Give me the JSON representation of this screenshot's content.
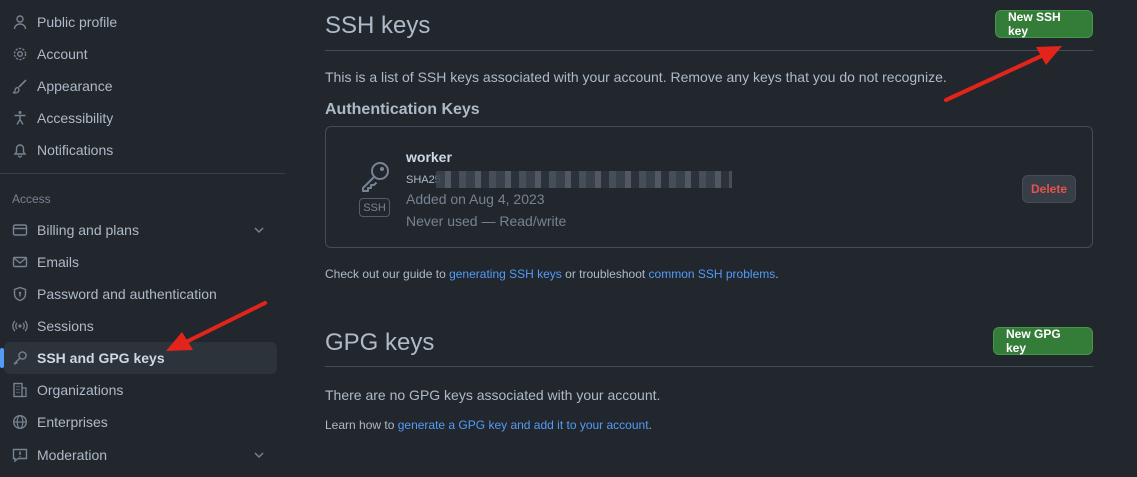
{
  "sidebar": {
    "items_top": [
      {
        "label": "Public profile",
        "icon": "person-icon"
      },
      {
        "label": "Account",
        "icon": "gear-icon"
      },
      {
        "label": "Appearance",
        "icon": "paintbrush-icon"
      },
      {
        "label": "Accessibility",
        "icon": "accessibility-icon"
      },
      {
        "label": "Notifications",
        "icon": "bell-icon"
      }
    ],
    "access_heading": "Access",
    "items_access": [
      {
        "label": "Billing and plans",
        "icon": "credit-card-icon"
      },
      {
        "label": "Emails",
        "icon": "mail-icon"
      },
      {
        "label": "Password and authentication",
        "icon": "shield-lock-icon"
      },
      {
        "label": "Sessions",
        "icon": "broadcast-icon"
      },
      {
        "label": "SSH and GPG keys",
        "icon": "key-icon"
      },
      {
        "label": "Organizations",
        "icon": "organization-icon"
      },
      {
        "label": "Enterprises",
        "icon": "globe-icon"
      },
      {
        "label": "Moderation",
        "icon": "report-icon"
      }
    ]
  },
  "ssh": {
    "title": "SSH keys",
    "new_button": "New SSH key",
    "description": "This is a list of SSH keys associated with your account. Remove any keys that you do not recognize.",
    "auth_heading": "Authentication Keys",
    "key": {
      "title": "worker",
      "fingerprint_prefix": "SHA25",
      "added": "Added on Aug 4, 2023",
      "usage": "Never used — Read/write",
      "badge": "SSH",
      "delete_label": "Delete"
    },
    "guide": {
      "prefix": "Check out our guide to ",
      "link1": "generating SSH keys",
      "middle": " or troubleshoot ",
      "link2": "common SSH problems",
      "suffix": "."
    }
  },
  "gpg": {
    "title": "GPG keys",
    "new_button": "New GPG key",
    "empty_text": "There are no GPG keys associated with your account.",
    "learn": {
      "prefix": "Learn how to ",
      "link": "generate a GPG key and add it to your account",
      "suffix": "."
    }
  },
  "colors": {
    "background": "#22272e",
    "accent": "#539bf5",
    "button_green": "#347d39",
    "danger": "#e5534b",
    "annotation_arrow": "#e3241b"
  }
}
